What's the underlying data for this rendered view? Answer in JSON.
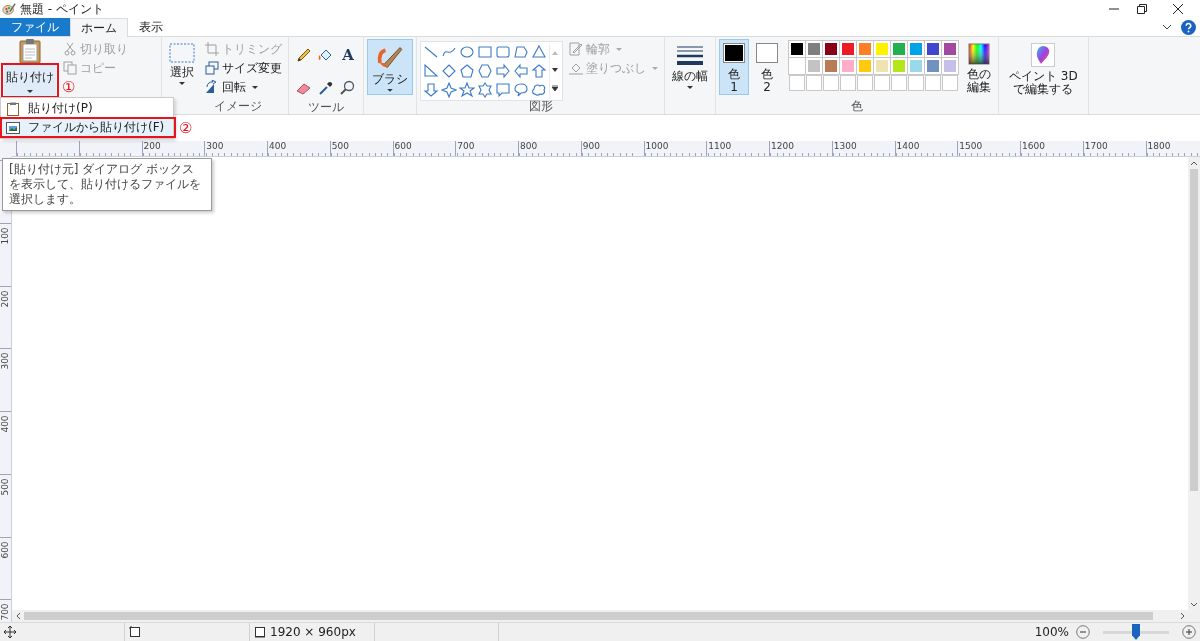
{
  "window": {
    "title": "無題 - ペイント"
  },
  "tabs": [
    {
      "kind": "file",
      "label": "ファイル",
      "selected": false
    },
    {
      "kind": "tab",
      "label": "ホーム",
      "selected": true
    },
    {
      "kind": "tab",
      "label": "表示",
      "selected": false
    }
  ],
  "clipboard": {
    "paste": {
      "label": "貼り付け"
    },
    "actions": [
      {
        "kind": "cut",
        "label": "切り取り",
        "disabled": true
      },
      {
        "kind": "copy",
        "label": "コピー",
        "disabled": true
      }
    ]
  },
  "image": {
    "label": "イメージ",
    "select": {
      "label": "選択"
    },
    "actions": [
      {
        "kind": "crop",
        "label": "トリミング",
        "disabled": true,
        "dropdown": false
      },
      {
        "kind": "resize",
        "label": "サイズ変更",
        "disabled": false,
        "dropdown": false
      },
      {
        "kind": "rotate",
        "label": "回転",
        "disabled": false,
        "dropdown": true
      }
    ]
  },
  "tools": {
    "label": "ツール",
    "text_tool": "A"
  },
  "brushes": {
    "label": "ブラシ",
    "selected": true
  },
  "shapes": {
    "label": "図形",
    "options": [
      {
        "kind": "outline",
        "label": "輪郭",
        "disabled": true
      },
      {
        "kind": "fill",
        "label": "塗りつぶし",
        "disabled": true
      }
    ]
  },
  "line_width": {
    "label": "線の幅"
  },
  "colors": {
    "label": "色",
    "slots": [
      {
        "label": "色",
        "number": "1",
        "color": "#000000",
        "selected": true
      },
      {
        "label": "色",
        "number": "2",
        "color": "#ffffff",
        "selected": false
      }
    ],
    "palette": [
      {
        "kind": "color",
        "color": "#000000"
      },
      {
        "kind": "color",
        "color": "#7f7f7f"
      },
      {
        "kind": "color",
        "color": "#880015"
      },
      {
        "kind": "color",
        "color": "#ed1c24"
      },
      {
        "kind": "color",
        "color": "#ff7f27"
      },
      {
        "kind": "color",
        "color": "#fff200"
      },
      {
        "kind": "color",
        "color": "#22b14c"
      },
      {
        "kind": "color",
        "color": "#00a2e8"
      },
      {
        "kind": "color",
        "color": "#3f48cc"
      },
      {
        "kind": "color",
        "color": "#a349a4"
      },
      {
        "kind": "color",
        "color": "#ffffff"
      },
      {
        "kind": "color",
        "color": "#c3c3c3"
      },
      {
        "kind": "color",
        "color": "#b97a57"
      },
      {
        "kind": "color",
        "color": "#ffaec9"
      },
      {
        "kind": "color",
        "color": "#ffc90e"
      },
      {
        "kind": "color",
        "color": "#efe4b0"
      },
      {
        "kind": "color",
        "color": "#b5e61d"
      },
      {
        "kind": "color",
        "color": "#99d9ea"
      },
      {
        "kind": "color",
        "color": "#7092be"
      },
      {
        "kind": "color",
        "color": "#c8bfe7"
      },
      {
        "kind": "empty"
      },
      {
        "kind": "empty"
      },
      {
        "kind": "empty"
      },
      {
        "kind": "empty"
      },
      {
        "kind": "empty"
      },
      {
        "kind": "empty"
      },
      {
        "kind": "empty"
      },
      {
        "kind": "empty"
      },
      {
        "kind": "empty"
      },
      {
        "kind": "empty"
      }
    ],
    "edit": {
      "lines": [
        "色の",
        "編集"
      ]
    }
  },
  "paint3d": {
    "lines": [
      "ペイント 3D",
      "で編集する"
    ]
  },
  "paste_menu": {
    "items": [
      {
        "kind": "paste",
        "label": "貼り付け(P)",
        "highlighted": false
      },
      {
        "kind": "paste-from",
        "label": "ファイルから貼り付け(F)",
        "highlighted": true
      }
    ]
  },
  "tooltip": {
    "text": "[貼り付け元] ダイアログ ボックスを表示して、貼り付けるファイルを選択します。"
  },
  "annotations": [
    {
      "label": "①"
    },
    {
      "label": "②"
    }
  ],
  "rulers": {
    "horizontal": [
      "200",
      "300",
      "400",
      "500",
      "600",
      "700",
      "800",
      "900",
      "1000",
      "1100",
      "1200",
      "1300",
      "1400",
      "1500",
      "1600",
      "1700",
      "1800"
    ],
    "vertical": [
      "100",
      "200",
      "300",
      "400",
      "500",
      "600",
      "700"
    ]
  },
  "status_bar": {
    "canvas_size": "1920 × 960px",
    "zoom": "100%",
    "zoom_slider": {
      "level": 0.5
    }
  }
}
